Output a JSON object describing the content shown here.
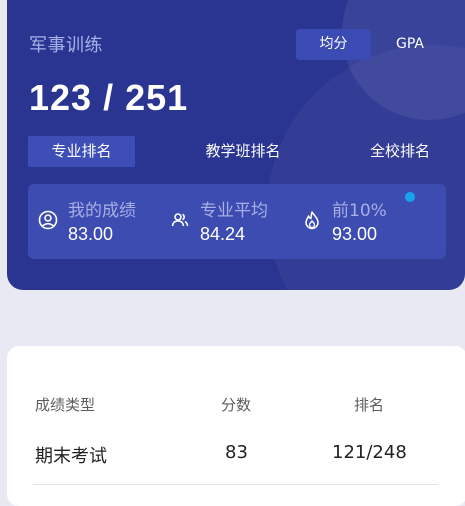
{
  "header": {
    "course_name": "军事训练",
    "toggle": {
      "options": [
        "均分",
        "GPA"
      ],
      "selected": "均分"
    },
    "rank_display": "123 / 251",
    "tabs": [
      "专业排名",
      "教学班排名",
      "全校排名"
    ],
    "active_tab": "专业排名"
  },
  "stats": [
    {
      "label": "我的成绩",
      "value": "83.00",
      "icon": "user-circle-icon"
    },
    {
      "label": "专业平均",
      "value": "84.24",
      "icon": "users-icon"
    },
    {
      "label": "前10%",
      "value": "93.00",
      "icon": "flame-icon"
    }
  ],
  "colors": {
    "hero_bg": "#2a3592",
    "active_accent": "#3d4fb7",
    "dot": "#19a3ef"
  },
  "table": {
    "headers": [
      "成绩类型",
      "分数",
      "排名"
    ],
    "rows": [
      [
        "期末考试",
        "83",
        "121/248"
      ]
    ]
  }
}
